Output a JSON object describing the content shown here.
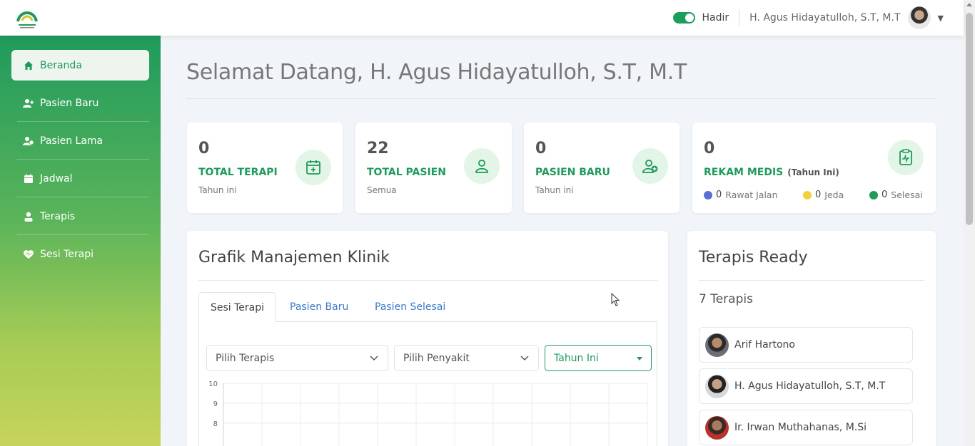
{
  "topbar": {
    "status_label": "Hadir",
    "user_name": "H. Agus Hidayatulloh, S.T, M.T"
  },
  "sidebar": {
    "items": [
      {
        "label": "Beranda",
        "icon": "home-icon",
        "active": true
      },
      {
        "label": "Pasien Baru",
        "icon": "user-plus-icon"
      },
      {
        "label": "Pasien Lama",
        "icon": "users-icon"
      },
      {
        "label": "Jadwal",
        "icon": "calendar-icon"
      },
      {
        "label": "Terapis",
        "icon": "user-icon"
      },
      {
        "label": "Sesi Terapi",
        "icon": "heart-icon"
      }
    ]
  },
  "welcome": "Selamat Datang, H. Agus Hidayatulloh, S.T, M.T",
  "stats": [
    {
      "value": "0",
      "title": "TOTAL TERAPI",
      "sub": "Tahun ini",
      "icon": "calendar-plus-icon"
    },
    {
      "value": "22",
      "title": "TOTAL PASIEN",
      "sub": "Semua",
      "icon": "user-icon"
    },
    {
      "value": "0",
      "title": "PASIEN BARU",
      "sub": "Tahun ini",
      "icon": "user-add-icon"
    },
    {
      "value": "0",
      "title": "REKAM MEDIS",
      "title_sub": "(Tahun Ini)",
      "icon": "medical-record-icon",
      "breakdown": [
        {
          "value": "0",
          "label": "Rawat Jalan",
          "color": "#5a6fd6"
        },
        {
          "value": "0",
          "label": "Jeda",
          "color": "#f2d13b"
        },
        {
          "value": "0",
          "label": "Selesai",
          "color": "#1f9a5c"
        }
      ]
    }
  ],
  "chart_panel": {
    "title": "Grafik Manajemen Klinik",
    "tabs": [
      "Sesi Terapi",
      "Pasien Baru",
      "Pasien Selesai"
    ],
    "filters": {
      "terapis": "Pilih Terapis",
      "penyakit": "Pilih Penyakit",
      "periode": "Tahun Ini"
    }
  },
  "chart_data": {
    "type": "line",
    "ylim": [
      0,
      10
    ],
    "visible_y_ticks": [
      "10",
      "9",
      "8"
    ],
    "grid": true,
    "series": []
  },
  "terapis_panel": {
    "title": "Terapis Ready",
    "count": "7 Terapis",
    "items": [
      {
        "name": "Arif Hartono"
      },
      {
        "name": "H. Agus Hidayatulloh, S.T, M.T"
      },
      {
        "name": "Ir. Irwan Muthahanas, M.Si"
      }
    ]
  },
  "colors": {
    "brand": "#1f9a5c",
    "link": "#3d78c9"
  }
}
